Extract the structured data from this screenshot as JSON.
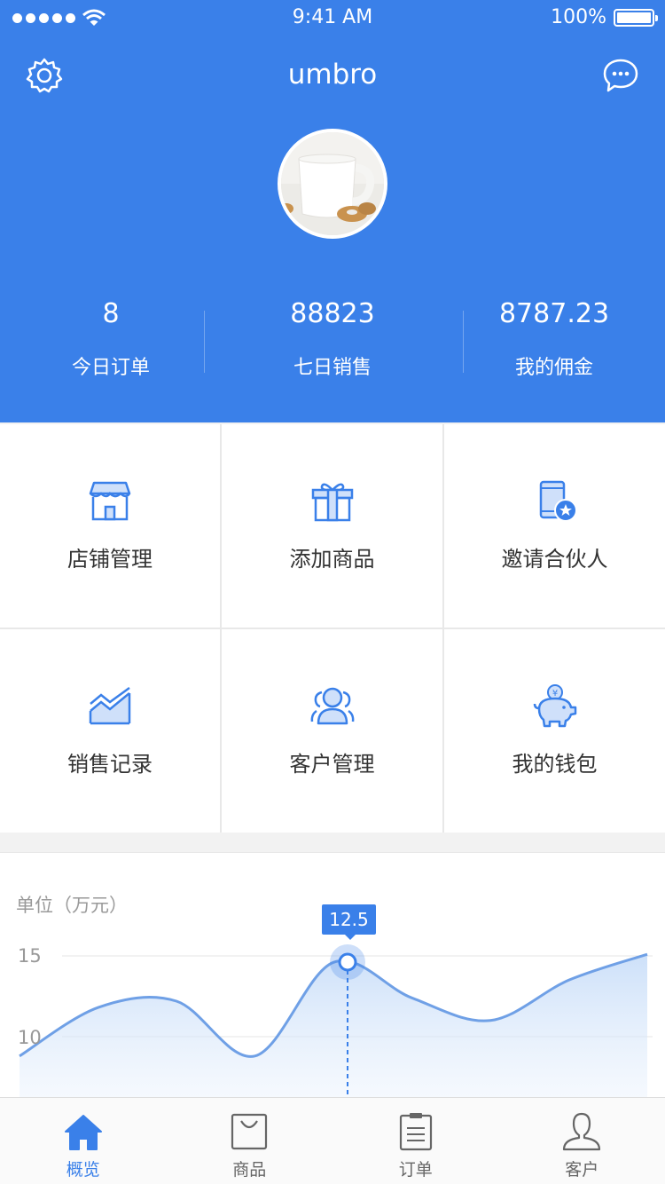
{
  "status_bar": {
    "time": "9:41 AM",
    "battery": "100%"
  },
  "header": {
    "title": "umbro"
  },
  "stats": [
    {
      "value": "8",
      "label": "今日订单"
    },
    {
      "value": "88823",
      "label": "七日销售"
    },
    {
      "value": "8787.23",
      "label": "我的佣金"
    }
  ],
  "grid": [
    {
      "label": "店铺管理",
      "icon": "store-icon"
    },
    {
      "label": "添加商品",
      "icon": "gift-icon"
    },
    {
      "label": "邀请合伙人",
      "icon": "phone-star-icon"
    },
    {
      "label": "销售记录",
      "icon": "area-chart-icon"
    },
    {
      "label": "客户管理",
      "icon": "users-icon"
    },
    {
      "label": "我的钱包",
      "icon": "piggy-bank-icon"
    }
  ],
  "chart": {
    "unit": "单位（万元）",
    "tick_15": "15",
    "tick_10": "10",
    "tooltip": "12.5"
  },
  "chart_data": {
    "type": "area",
    "ylabel": "单位（万元）",
    "yticks": [
      10,
      15
    ],
    "x": [
      0,
      1,
      2,
      3,
      4,
      5,
      6,
      7,
      8
    ],
    "series": [
      {
        "values": [
          8.8,
          11.8,
          12.2,
          8.8,
          14.6,
          12.4,
          11.0,
          13.5,
          15.1
        ]
      }
    ],
    "highlight": {
      "x": 4,
      "label": "12.5"
    },
    "grid": true
  },
  "colors": {
    "primary": "#3a80e9"
  },
  "tabs": [
    {
      "label": "概览",
      "icon": "home-icon",
      "active": true
    },
    {
      "label": "商品",
      "icon": "bag-icon",
      "active": false
    },
    {
      "label": "订单",
      "icon": "clipboard-icon",
      "active": false
    },
    {
      "label": "客户",
      "icon": "person-icon",
      "active": false
    }
  ]
}
